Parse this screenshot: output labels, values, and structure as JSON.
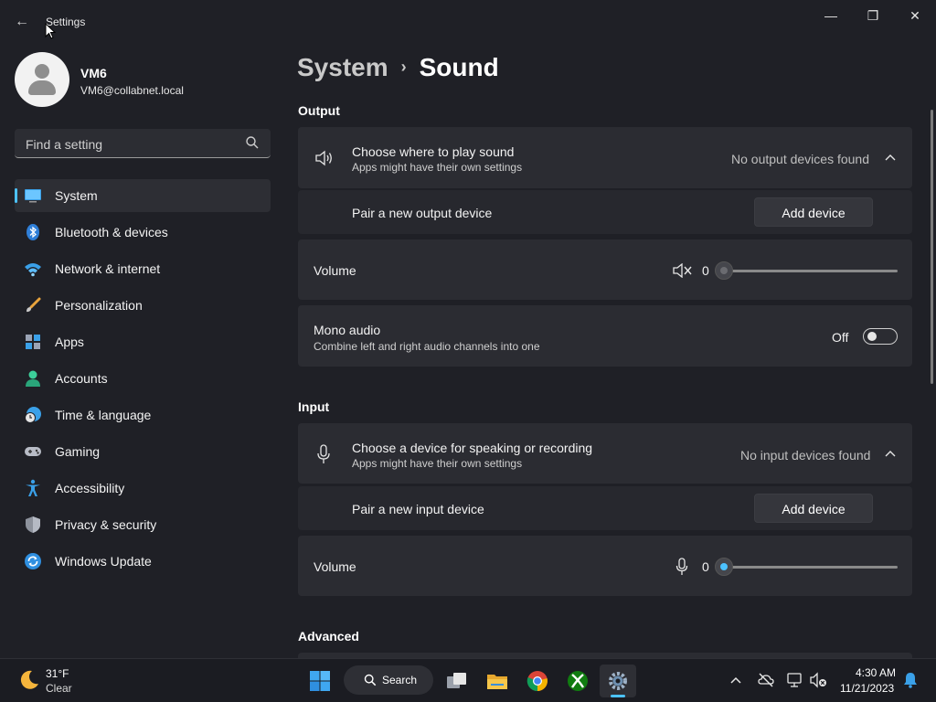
{
  "window": {
    "title": "Settings",
    "minimize_glyph": "—",
    "maximize_glyph": "❐",
    "close_glyph": "✕",
    "back_glyph": "←"
  },
  "user": {
    "name": "VM6",
    "email": "VM6@collabnet.local"
  },
  "search": {
    "placeholder": "Find a setting"
  },
  "sidebar": {
    "items": [
      {
        "label": "System",
        "icon": "system-icon"
      },
      {
        "label": "Bluetooth & devices",
        "icon": "bluetooth-icon"
      },
      {
        "label": "Network & internet",
        "icon": "wifi-icon"
      },
      {
        "label": "Personalization",
        "icon": "brush-icon"
      },
      {
        "label": "Apps",
        "icon": "apps-icon"
      },
      {
        "label": "Accounts",
        "icon": "accounts-icon"
      },
      {
        "label": "Time & language",
        "icon": "globe-clock-icon"
      },
      {
        "label": "Gaming",
        "icon": "gamepad-icon"
      },
      {
        "label": "Accessibility",
        "icon": "accessibility-icon"
      },
      {
        "label": "Privacy & security",
        "icon": "shield-icon"
      },
      {
        "label": "Windows Update",
        "icon": "update-icon"
      }
    ],
    "active_index": 0
  },
  "breadcrumb": {
    "parent": "System",
    "separator": "›",
    "current": "Sound"
  },
  "output": {
    "heading": "Output",
    "device_title": "Choose where to play sound",
    "device_subtitle": "Apps might have their own settings",
    "device_status": "No output devices found",
    "pair_label": "Pair a new output device",
    "add_button": "Add device",
    "volume_label": "Volume",
    "volume_value": "0",
    "mono_title": "Mono audio",
    "mono_subtitle": "Combine left and right audio channels into one",
    "mono_state": "Off"
  },
  "input": {
    "heading": "Input",
    "device_title": "Choose a device for speaking or recording",
    "device_subtitle": "Apps might have their own settings",
    "device_status": "No input devices found",
    "pair_label": "Pair a new input device",
    "add_button": "Add device",
    "volume_label": "Volume",
    "volume_value": "0"
  },
  "advanced": {
    "heading": "Advanced"
  },
  "taskbar": {
    "weather_temp": "31°F",
    "weather_condition": "Clear",
    "search_label": "Search",
    "time": "4:30 AM",
    "date": "11/21/2023"
  },
  "colors": {
    "accent": "#4cc2ff",
    "background": "#1f2026",
    "card": "#2b2c32"
  }
}
